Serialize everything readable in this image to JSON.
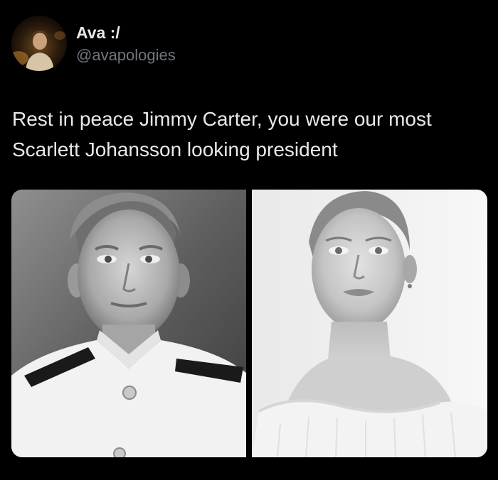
{
  "author": {
    "display_name": "Ava :/",
    "handle": "@avapologies",
    "avatar_icon": "user-avatar"
  },
  "tweet": {
    "text_line_1": "Rest in peace Jimmy Carter, you were our most",
    "text_line_2": "Scarlett Johansson looking president"
  },
  "media": {
    "photo_count": 2,
    "photos": [
      {
        "kind": "black-and-white portrait",
        "icon": "portrait-photo"
      },
      {
        "kind": "black-and-white portrait",
        "icon": "portrait-photo"
      }
    ]
  },
  "colors": {
    "background": "#000000",
    "primary_text": "#e7e9ea",
    "secondary_text": "#71767b"
  }
}
